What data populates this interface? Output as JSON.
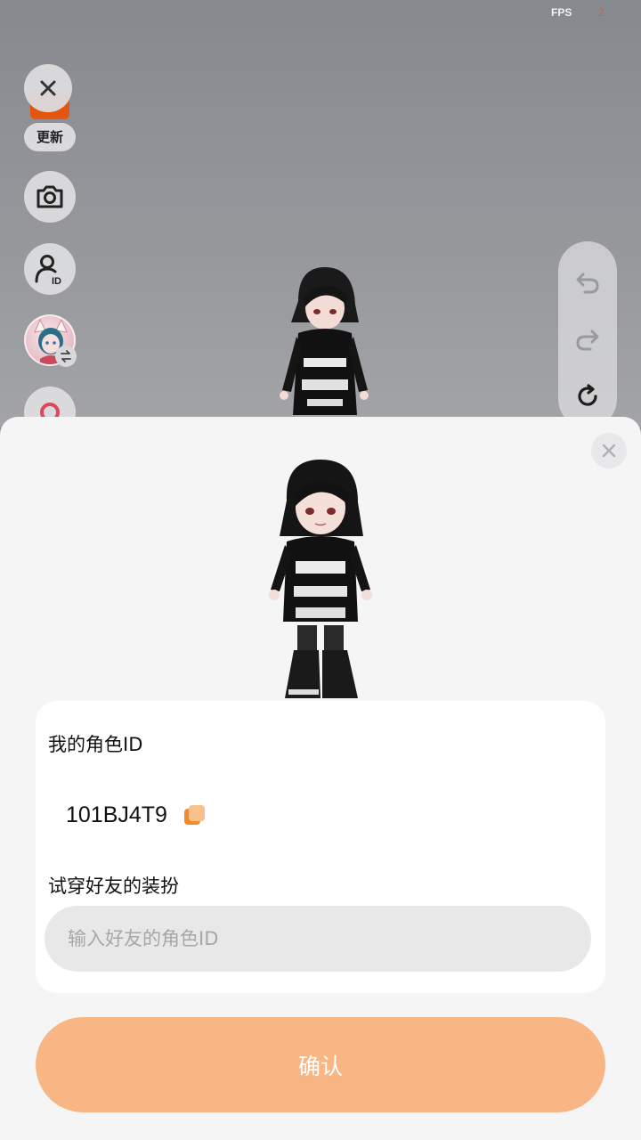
{
  "scene": {
    "fps_label": "FPS",
    "fps_value": "2"
  },
  "left_toolbar": {
    "update_label": "更新"
  },
  "dialog": {
    "my_id_label": "我的角色ID",
    "my_id_value": "101BJ4T9",
    "tryon_label": "试穿好友的装扮",
    "input_placeholder": "输入好友的角色ID",
    "input_value": "",
    "confirm_label": "确认"
  },
  "colors": {
    "accent": "#f8b685",
    "copy_icon": "#f08a2a",
    "record": "#e0455c"
  }
}
